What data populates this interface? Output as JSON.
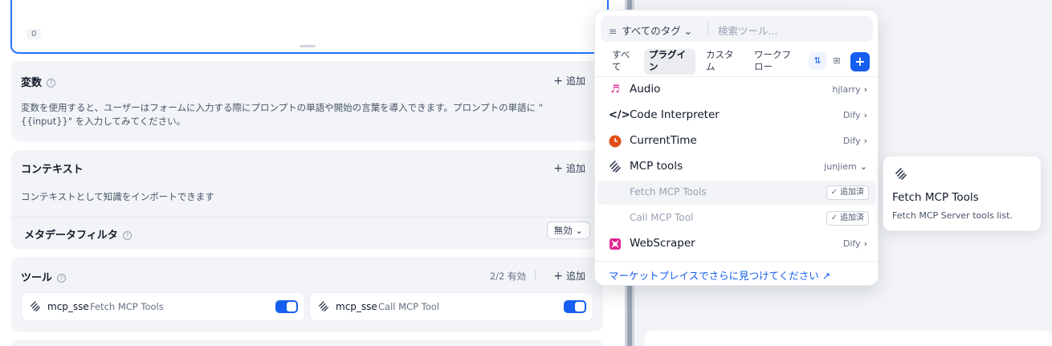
{
  "prompt": {
    "char_count": "0"
  },
  "variables": {
    "title": "変数",
    "add_label": "追加",
    "description": "変数を使用すると、ユーザーはフォームに入力する際にプロンプトの単語や開始の言葉を導入できます。プロンプトの単語に \"{{input}}\" を入力してみてください。"
  },
  "context": {
    "title": "コンテキスト",
    "add_label": "追加",
    "description": "コンテキストとして知識をインポートできます",
    "metadata_filter_label": "メタデータフィルタ",
    "metadata_filter_value": "無効"
  },
  "tools": {
    "title": "ツール",
    "enabled_count": "2/2 有効",
    "add_label": "追加",
    "items": [
      {
        "provider": "mcp_sse",
        "name": "Fetch MCP Tools",
        "enabled": true
      },
      {
        "provider": "mcp_sse",
        "name": "Call MCP Tool",
        "enabled": true
      }
    ]
  },
  "picker": {
    "tag_filter": "すべてのタグ",
    "search_placeholder": "検索ツール...",
    "tabs": [
      "すべて",
      "プラグイン",
      "カスタム",
      "ワークフロー"
    ],
    "active_tab": "プラグイン",
    "items": [
      {
        "name": "Audio",
        "author": "hjlarry",
        "icon": "audio-icon",
        "color": "#dd2590"
      },
      {
        "name": "Code Interpreter",
        "author": "Dify",
        "icon": "code-icon",
        "color": "#101828"
      },
      {
        "name": "CurrentTime",
        "author": "Dify",
        "icon": "clock-icon",
        "color": "#e04f16"
      },
      {
        "name": "MCP tools",
        "author": "junjiem",
        "icon": "mcp-icon",
        "color": "#344054"
      },
      {
        "name": "WebScraper",
        "author": "Dify",
        "icon": "webscraper-icon",
        "color": "#dd2590"
      }
    ],
    "sub_tools": [
      {
        "name": "Fetch MCP Tools",
        "badge": "追加済"
      },
      {
        "name": "Call MCP Tool",
        "badge": "追加済"
      }
    ],
    "marketplace_link": "マーケットプレイスでさらに見つけてください ↗"
  },
  "tooltip": {
    "title": "Fetch MCP Tools",
    "description": "Fetch MCP Server tools list."
  },
  "colors": {
    "accent": "#155eef",
    "focus_border": "#2970ff"
  }
}
